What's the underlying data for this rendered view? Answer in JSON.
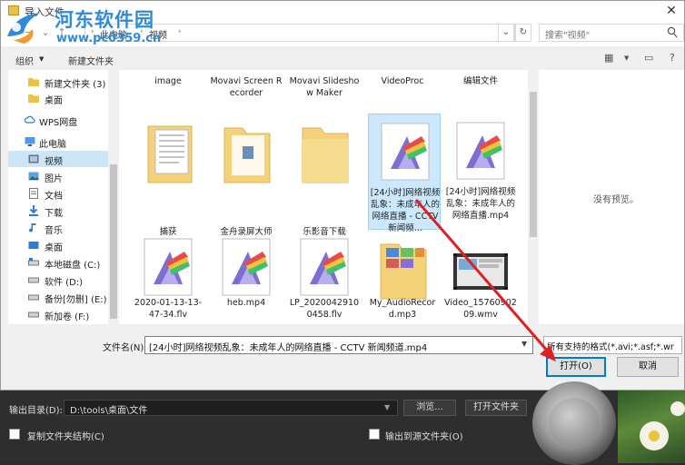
{
  "dialog": {
    "title": "导入文件",
    "address": {
      "crumbs": [
        "此电脑",
        "视频"
      ],
      "search_placeholder": "搜索\"视频\""
    },
    "toolbar": {
      "organize_label": "组织",
      "new_folder_label": "新建文件夹"
    },
    "sidebar": {
      "items": [
        {
          "label": "新建文件夹 (3)",
          "icon": "folder-icon"
        },
        {
          "label": "桌面",
          "icon": "folder-icon"
        },
        {
          "label": "WPS网盘",
          "icon": "cloud-icon"
        },
        {
          "label": "此电脑",
          "icon": "computer-icon"
        },
        {
          "label": "视频",
          "icon": "video-icon",
          "selected": true
        },
        {
          "label": "图片",
          "icon": "picture-icon"
        },
        {
          "label": "文档",
          "icon": "document-icon"
        },
        {
          "label": "下载",
          "icon": "download-icon"
        },
        {
          "label": "音乐",
          "icon": "music-icon"
        },
        {
          "label": "桌面",
          "icon": "desktop-icon"
        },
        {
          "label": "本地磁盘 (C:)",
          "icon": "drive-icon"
        },
        {
          "label": "软件 (D:)",
          "icon": "drive-icon"
        },
        {
          "label": "备份[勿删] (E:)",
          "icon": "drive-icon"
        },
        {
          "label": "新加卷 (F:)",
          "icon": "drive-icon"
        }
      ]
    },
    "files": [
      {
        "name": "image",
        "type": "folder-partial"
      },
      {
        "name": "Movavi Screen Recorder",
        "type": "folder-partial"
      },
      {
        "name": "Movavi Slideshow Maker",
        "type": "folder-partial"
      },
      {
        "name": "VideoProc",
        "type": "folder-partial"
      },
      {
        "name": "编辑文件",
        "type": "folder-partial"
      },
      {
        "name": "捕获",
        "type": "folder-docs"
      },
      {
        "name": "金舟录屏大师",
        "type": "folder-app"
      },
      {
        "name": "乐影音下载",
        "type": "folder"
      },
      {
        "name": "[24小时]网络视频乱象：未成年人的网络直播 - CCTV 新闻频...",
        "type": "video",
        "selected": true
      },
      {
        "name": "[24小时]网络视频乱象：未成年人的网络直播.mp4",
        "type": "video"
      },
      {
        "name": "2020-01-13-13-47-34.flv",
        "type": "video"
      },
      {
        "name": "heb.mp4",
        "type": "video"
      },
      {
        "name": "LP_20200429100458.flv",
        "type": "video"
      },
      {
        "name": "My_AudioRecord.mp3",
        "type": "audio-folder"
      },
      {
        "name": "Video_1576090209.wmv",
        "type": "video-thumb"
      }
    ],
    "preview_text": "没有预览。",
    "filename": {
      "label": "文件名(N):",
      "value": "[24小时]网络视频乱象：未成年人的网络直播 - CCTV 新闻频道.mp4"
    },
    "filetype": {
      "value": "所有支持的格式(*.avi;*.asf;*.wr"
    },
    "open_label": "打开(O)",
    "cancel_label": "取消"
  },
  "watermark": {
    "title": "河东软件园",
    "url": "www.pc0359.cn"
  },
  "app": {
    "output_label": "输出目录(D):",
    "output_value": "D:\\tools\\桌面\\文件",
    "browse_label": "浏览...",
    "open_folder_label": "打开文件夹",
    "copy_structure_label": "复制文件夹结构(C)",
    "output_to_source_label": "输出到源文件夹(O)"
  },
  "colors": {
    "accent": "#0078d7",
    "selection": "#cce8ff",
    "annotation_arrow": "#e02020",
    "watermark": "#2f8ad9"
  }
}
